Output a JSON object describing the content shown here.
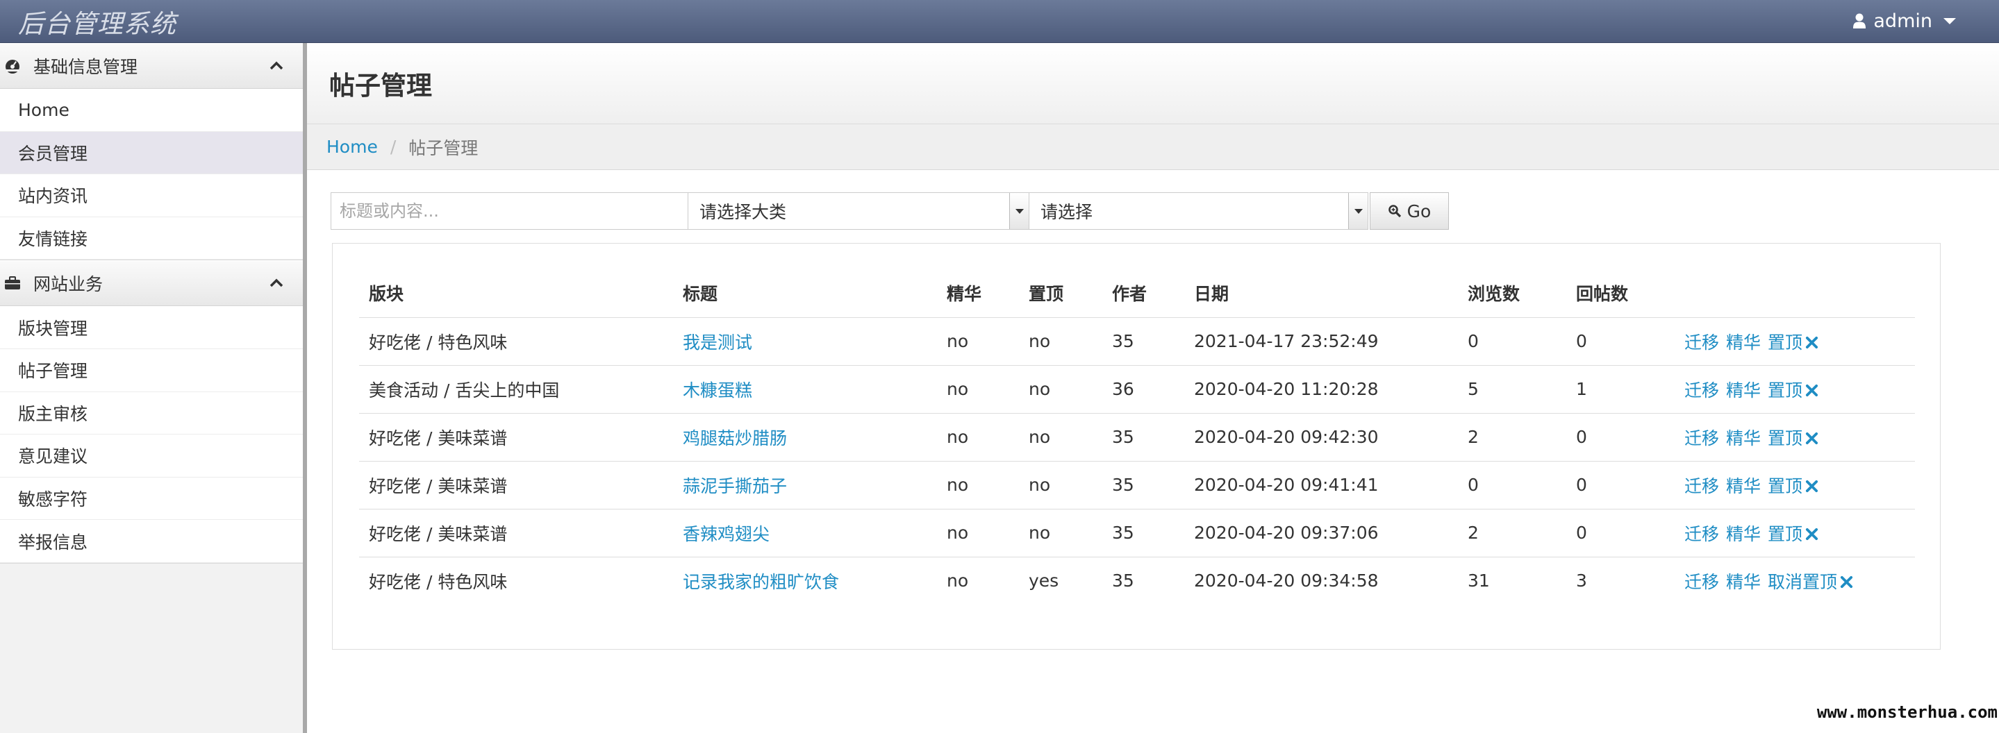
{
  "navbar": {
    "brand": "后台管理系统",
    "user": "admin"
  },
  "sidebar": {
    "groups": [
      {
        "title": "基础信息管理",
        "icon": "dashboard-icon",
        "items": [
          {
            "label": "Home"
          },
          {
            "label": "会员管理",
            "active": true
          },
          {
            "label": "站内资讯"
          },
          {
            "label": "友情链接"
          }
        ]
      },
      {
        "title": "网站业务",
        "icon": "briefcase-icon",
        "items": [
          {
            "label": "版块管理"
          },
          {
            "label": "帖子管理"
          },
          {
            "label": "版主审核"
          },
          {
            "label": "意见建议"
          },
          {
            "label": "敏感字符"
          },
          {
            "label": "举报信息"
          }
        ]
      }
    ]
  },
  "main": {
    "title": "帖子管理",
    "breadcrumb": {
      "home": "Home",
      "separator": "/",
      "current": "帖子管理"
    },
    "filter": {
      "search_placeholder": "标题或内容...",
      "category_selected": "请选择大类",
      "subcategory_selected": "请选择",
      "go_label": "Go"
    },
    "table": {
      "headers": [
        "版块",
        "标题",
        "精华",
        "置顶",
        "作者",
        "日期",
        "浏览数",
        "回帖数"
      ],
      "rows": [
        {
          "section": "好吃佬 / 特色风味",
          "title": "我是测试",
          "elite": "no",
          "top": "no",
          "author": "35",
          "date": "2021-04-17 23:52:49",
          "views": "0",
          "replies": "0",
          "actions": [
            "迁移",
            "精华",
            "置顶"
          ]
        },
        {
          "section": "美食活动 / 舌尖上的中国",
          "title": "木糠蛋糕",
          "elite": "no",
          "top": "no",
          "author": "36",
          "date": "2020-04-20 11:20:28",
          "views": "5",
          "replies": "1",
          "actions": [
            "迁移",
            "精华",
            "置顶"
          ]
        },
        {
          "section": "好吃佬 / 美味菜谱",
          "title": "鸡腿菇炒腊肠",
          "elite": "no",
          "top": "no",
          "author": "35",
          "date": "2020-04-20 09:42:30",
          "views": "2",
          "replies": "0",
          "actions": [
            "迁移",
            "精华",
            "置顶"
          ]
        },
        {
          "section": "好吃佬 / 美味菜谱",
          "title": "蒜泥手撕茄子",
          "elite": "no",
          "top": "no",
          "author": "35",
          "date": "2020-04-20 09:41:41",
          "views": "0",
          "replies": "0",
          "actions": [
            "迁移",
            "精华",
            "置顶"
          ]
        },
        {
          "section": "好吃佬 / 美味菜谱",
          "title": "香辣鸡翅尖",
          "elite": "no",
          "top": "no",
          "author": "35",
          "date": "2020-04-20 09:37:06",
          "views": "2",
          "replies": "0",
          "actions": [
            "迁移",
            "精华",
            "置顶"
          ]
        },
        {
          "section": "好吃佬 / 特色风味",
          "title": "记录我家的粗旷饮食",
          "elite": "no",
          "top": "yes",
          "author": "35",
          "date": "2020-04-20 09:34:58",
          "views": "31",
          "replies": "3",
          "actions": [
            "迁移",
            "精华",
            "取消置顶"
          ]
        }
      ]
    }
  },
  "watermark": "www.monsterhua.com",
  "colors": {
    "navbar_top": "#6b7a99",
    "navbar_bottom": "#4d5b7b",
    "link": "#1f8dc4",
    "active_item": "#e6e4ed",
    "sidebar_divider": "#a9a9a9"
  }
}
